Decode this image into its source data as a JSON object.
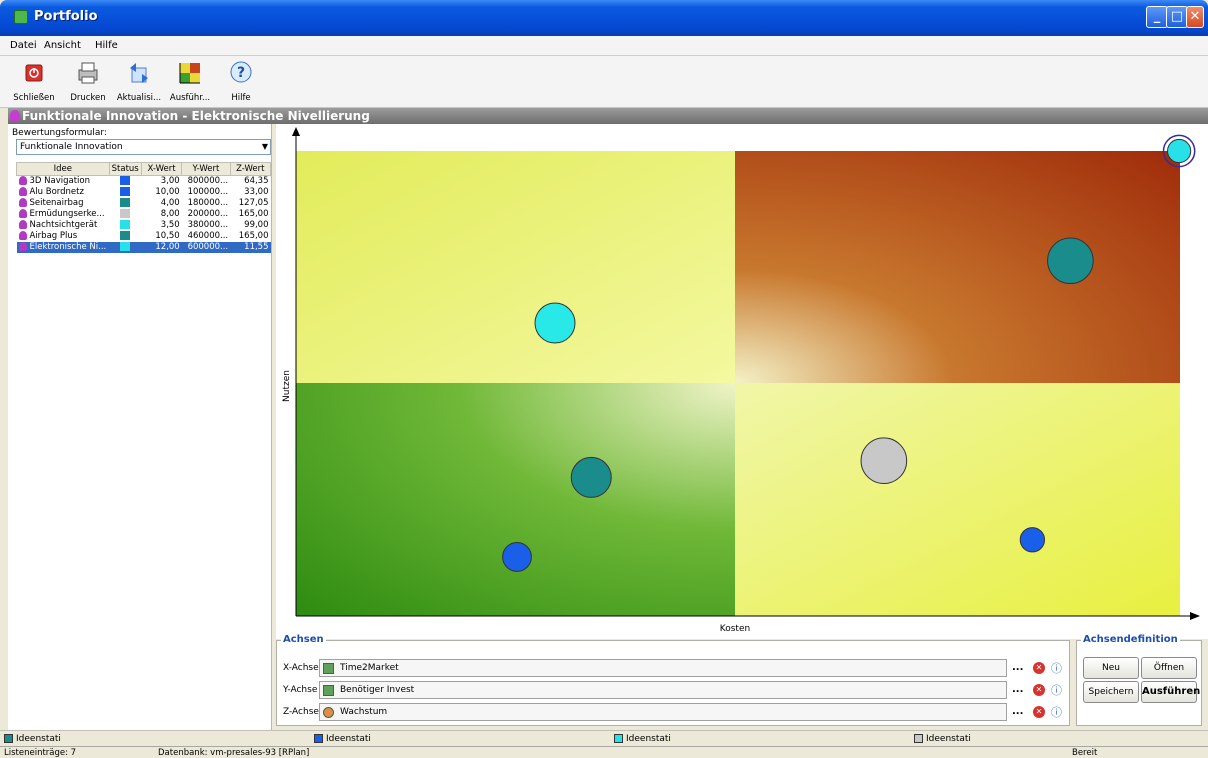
{
  "window": {
    "title": "Portfolio"
  },
  "menu": [
    "Datei",
    "Ansicht",
    "Hilfe"
  ],
  "toolbar": [
    {
      "label": "Schließen",
      "icon": "close-power-icon"
    },
    {
      "label": "Drucken",
      "icon": "printer-icon"
    },
    {
      "label": "Aktualisi...",
      "icon": "refresh-icon"
    },
    {
      "label": "Ausführ...",
      "icon": "portfolio-chart-icon"
    },
    {
      "label": "Hilfe",
      "icon": "help-icon"
    }
  ],
  "header": {
    "title": "Funktionale Innovation - Elektronische Nivellierung"
  },
  "left": {
    "form_label": "Bewertungsformular:",
    "form_value": "Funktionale Innovation",
    "columns": [
      "Idee",
      "Status",
      "X-Wert",
      "Y-Wert",
      "Z-Wert"
    ],
    "rows": [
      {
        "idee": "3D Navigation",
        "status_color": "#1a5fe8",
        "x": "3,00",
        "y": "800000...",
        "z": "64,35"
      },
      {
        "idee": "Alu Bordnetz",
        "status_color": "#1a5fe8",
        "x": "10,00",
        "y": "100000...",
        "z": "33,00"
      },
      {
        "idee": "Seitenairbag",
        "status_color": "#1a8c8c",
        "x": "4,00",
        "y": "180000...",
        "z": "127,05"
      },
      {
        "idee": "Ermüdungserke...",
        "status_color": "#c8c8c8",
        "x": "8,00",
        "y": "200000...",
        "z": "165,00"
      },
      {
        "idee": "Nachtsichtgerät",
        "status_color": "#28e0e8",
        "x": "3,50",
        "y": "380000...",
        "z": "99,00"
      },
      {
        "idee": "Airbag Plus",
        "status_color": "#1a8c8c",
        "x": "10,50",
        "y": "460000...",
        "z": "165,00"
      },
      {
        "idee": "Elektronische Ni...",
        "status_color": "#28e0e8",
        "x": "12,00",
        "y": "600000...",
        "z": "11,55",
        "selected": true
      }
    ]
  },
  "chart_data": {
    "type": "scatter",
    "xlabel": "Kosten",
    "ylabel": "Nutzen",
    "points": [
      {
        "color": "#28e8e8",
        "cx": 0.293,
        "cy": 0.37,
        "size": 0.5
      },
      {
        "color": "#1a8c8c",
        "cx": 0.876,
        "cy": 0.236,
        "size": 0.6
      },
      {
        "color": "#1a8c8c",
        "cx": 0.334,
        "cy": 0.702,
        "size": 0.5
      },
      {
        "color": "#c8c8c8",
        "cx": 0.665,
        "cy": 0.666,
        "size": 0.6
      },
      {
        "color": "#1a5fe8",
        "cx": 0.25,
        "cy": 0.873,
        "size": 0.3
      },
      {
        "color": "#1a5fe8",
        "cx": 0.833,
        "cy": 0.836,
        "size": 0.22
      },
      {
        "color": "#28e0e8",
        "cx": 0.999,
        "cy": 0.0,
        "size": 0.2,
        "selected": true
      }
    ]
  },
  "achsen": {
    "legend": "Achsen",
    "rows": [
      {
        "label": "X-Achse",
        "value": "Time2Market",
        "icon": "attribute-icon"
      },
      {
        "label": "Y-Achse",
        "value": "Benötiger Invest",
        "icon": "attribute-icon"
      },
      {
        "label": "Z-Achse",
        "value": "Wachstum",
        "icon": "person-icon"
      }
    ],
    "dots": "..."
  },
  "achsendef": {
    "legend": "Achsendefinition",
    "neu": "Neu",
    "offnen": "Öffnen",
    "speichern": "Speichern",
    "ausfuhren": "Ausführen"
  },
  "legend": [
    {
      "label": "Ideenstati",
      "color": "#1a8c8c"
    },
    {
      "label": "Ideenstati",
      "color": "#1a5fe8"
    },
    {
      "label": "Ideenstati",
      "color": "#28e0e8"
    },
    {
      "label": "Ideenstati",
      "color": "#c8c8c8"
    }
  ],
  "status": {
    "left": "Listeneinträge: 7",
    "mid": "Datenbank: vm-presales-93 [RPlan]",
    "right": "Bereit"
  }
}
